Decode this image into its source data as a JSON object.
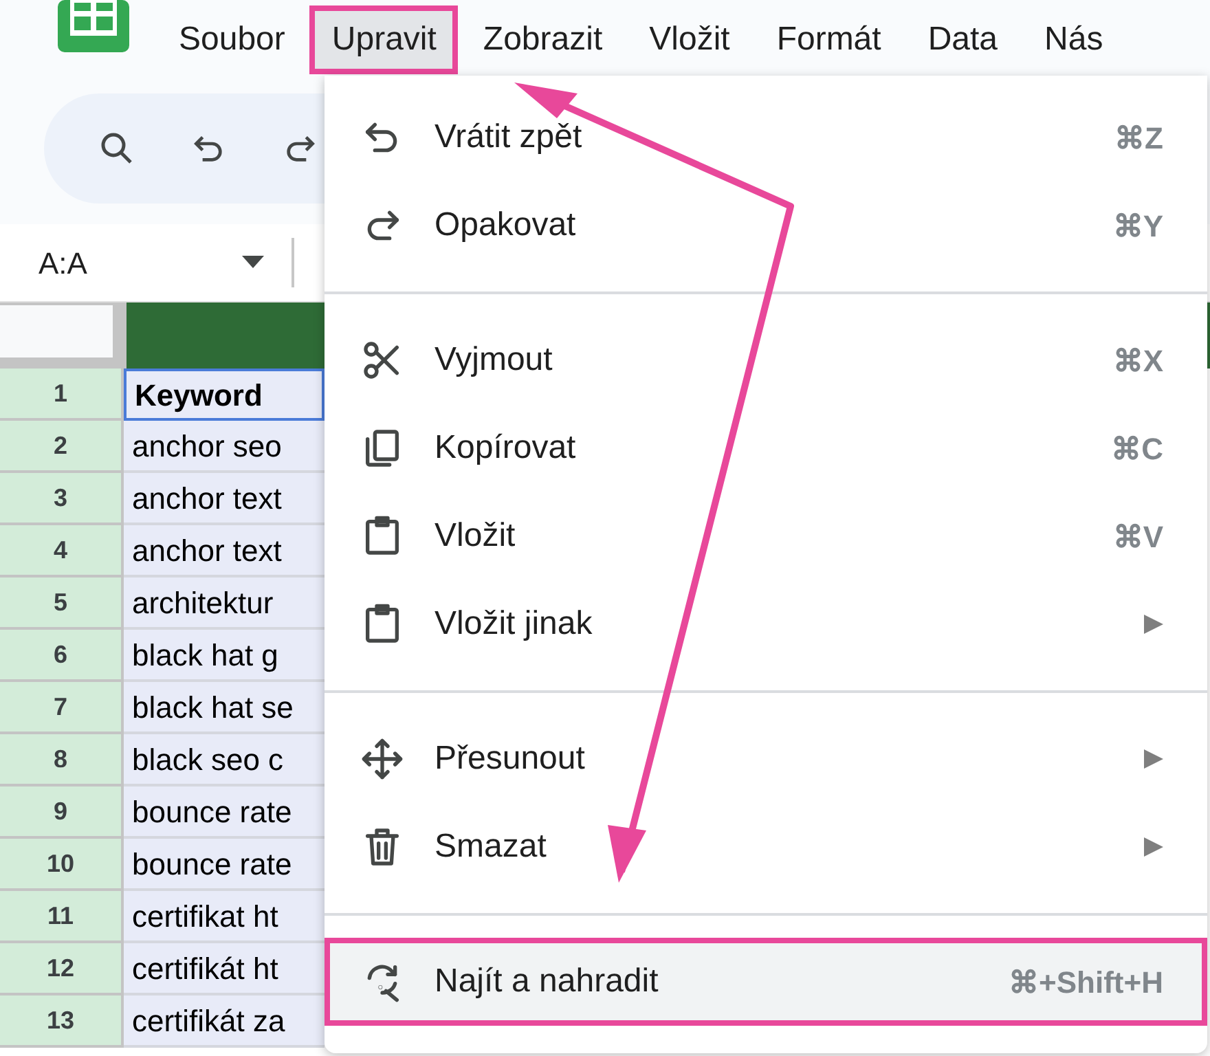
{
  "menu_bar": [
    {
      "label": "Soubor",
      "selected": false,
      "highlighted": false
    },
    {
      "label": "Upravit",
      "selected": true,
      "highlighted": true
    },
    {
      "label": "Zobrazit",
      "selected": false,
      "highlighted": false
    },
    {
      "label": "Vložit",
      "selected": false,
      "highlighted": false
    },
    {
      "label": "Formát",
      "selected": false,
      "highlighted": false
    },
    {
      "label": "Data",
      "selected": false,
      "highlighted": false
    },
    {
      "label": "Nás",
      "selected": false,
      "highlighted": false
    }
  ],
  "name_box": {
    "value": "A:A"
  },
  "grid": {
    "rows": [
      {
        "number": "1",
        "cell": "Keyword",
        "active": true
      },
      {
        "number": "2",
        "cell": "anchor seo",
        "active": false
      },
      {
        "number": "3",
        "cell": "anchor text",
        "active": false
      },
      {
        "number": "4",
        "cell": "anchor text",
        "active": false
      },
      {
        "number": "5",
        "cell": "architektur",
        "active": false
      },
      {
        "number": "6",
        "cell": "black hat g",
        "active": false
      },
      {
        "number": "7",
        "cell": "black hat se",
        "active": false
      },
      {
        "number": "8",
        "cell": "black seo c",
        "active": false
      },
      {
        "number": "9",
        "cell": "bounce rate",
        "active": false
      },
      {
        "number": "10",
        "cell": "bounce rate",
        "active": false
      },
      {
        "number": "11",
        "cell": "certifikat ht",
        "active": false
      },
      {
        "number": "12",
        "cell": "certifikát ht",
        "active": false
      },
      {
        "number": "13",
        "cell": "certifikát za",
        "active": false
      }
    ]
  },
  "menu": {
    "groups": [
      [
        {
          "label": "Vrátit zpět",
          "shortcut": "⌘Z",
          "submenu": false,
          "highlighted": false
        },
        {
          "label": "Opakovat",
          "shortcut": "⌘Y",
          "submenu": false,
          "highlighted": false
        }
      ],
      [
        {
          "label": "Vyjmout",
          "shortcut": "⌘X",
          "submenu": false,
          "highlighted": false
        },
        {
          "label": "Kopírovat",
          "shortcut": "⌘C",
          "submenu": false,
          "highlighted": false
        },
        {
          "label": "Vložit",
          "shortcut": "⌘V",
          "submenu": false,
          "highlighted": false
        },
        {
          "label": "Vložit jinak",
          "submenu": true,
          "highlighted": false
        }
      ],
      [
        {
          "label": "Přesunout",
          "submenu": true,
          "highlighted": false
        },
        {
          "label": "Smazat",
          "submenu": true,
          "highlighted": false
        }
      ],
      [
        {
          "label": "Najít a nahradit",
          "shortcut": "⌘+Shift+H",
          "submenu": false,
          "highlighted": true
        }
      ]
    ]
  }
}
